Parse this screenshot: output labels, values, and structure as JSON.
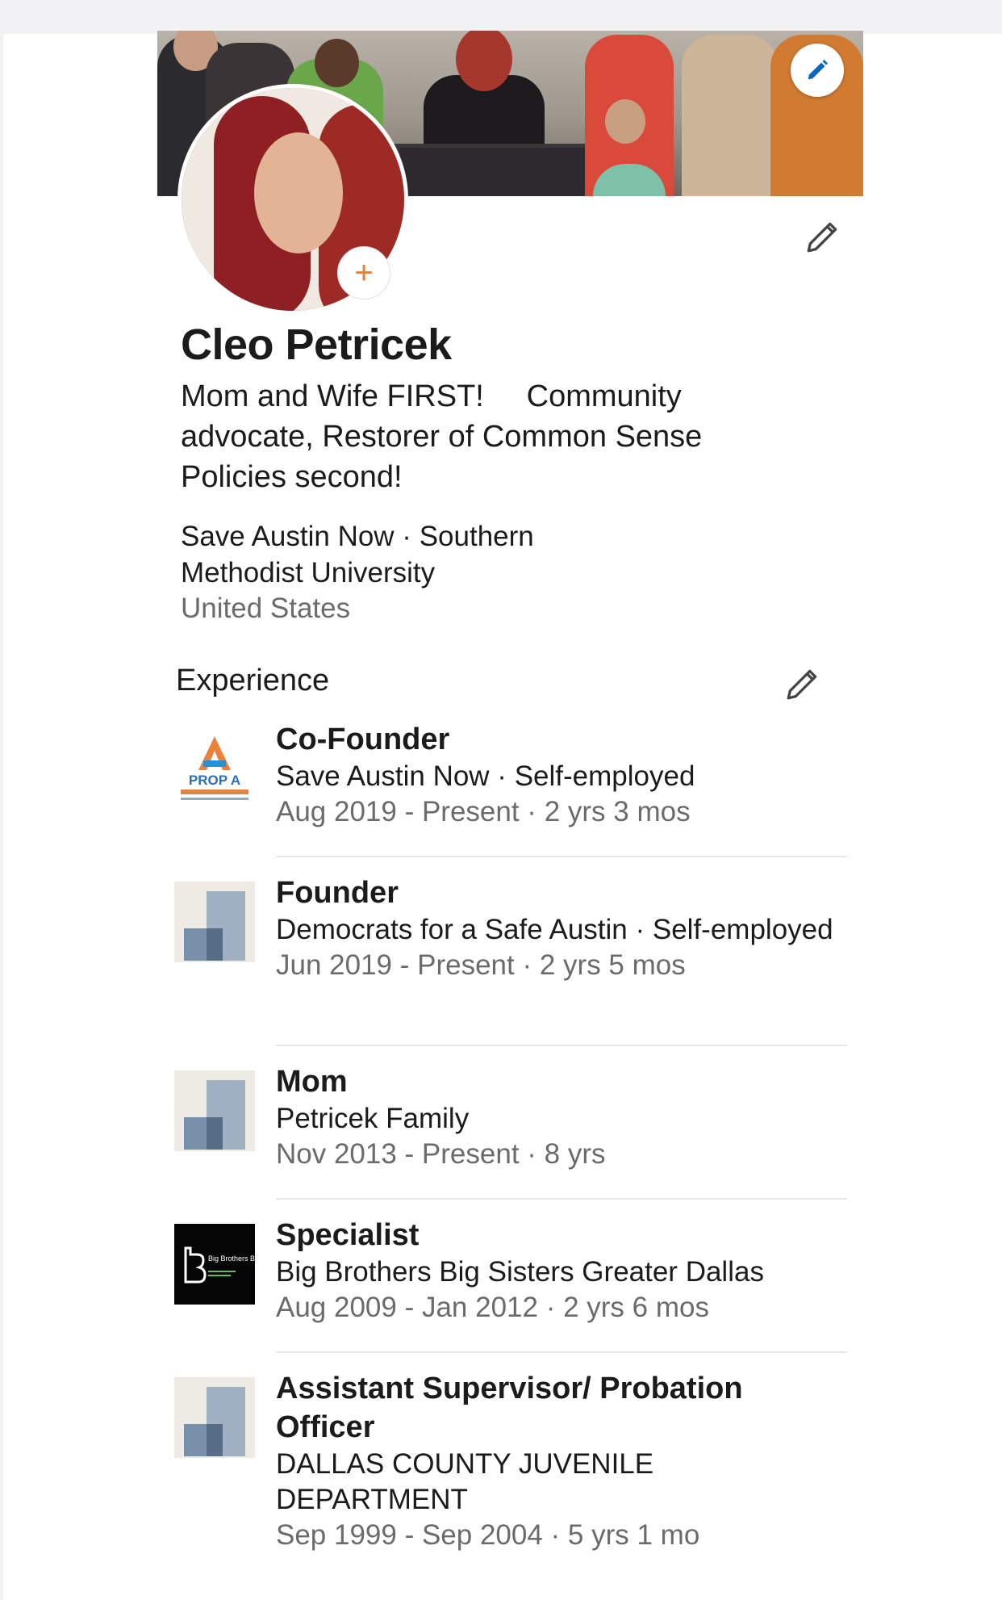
{
  "profile": {
    "name": "Cleo Petricek",
    "headline": "Mom and Wife FIRST!     Community advocate, Restorer of Common Sense Policies second!",
    "org_line": "Save Austin Now · Southern Methodist University",
    "location": "United States"
  },
  "icons": {
    "banner_edit": "pencil-icon",
    "add_photo": "plus-icon",
    "intro_edit": "pencil-icon",
    "experience_edit": "pencil-icon"
  },
  "colors": {
    "accent_blue": "#0a66c2",
    "add_orange": "#e47f38",
    "secondary_text": "#6b6b6b"
  },
  "add_photo_symbol": "+",
  "experience": {
    "title": "Experience",
    "items": [
      {
        "logo": "prop-a-logo",
        "logo_text": "PROP A",
        "title": "Co-Founder",
        "org": "Save Austin Now · Self-employed",
        "dates": "Aug 2019 - Present · 2 yrs 3 mos"
      },
      {
        "logo": "generic-company-logo",
        "title": "Founder",
        "org": "Democrats for a Safe Austin · Self-employed",
        "dates": "Jun 2019 - Present · 2 yrs 5 mos"
      },
      {
        "logo": "generic-company-logo",
        "title": "Mom",
        "org": "Petricek Family",
        "dates": "Nov 2013 - Present · 8 yrs"
      },
      {
        "logo": "big-brothers-big-sisters-logo",
        "logo_text": "Big Brothers Big Sisters",
        "title": "Specialist",
        "org": "Big Brothers Big Sisters Greater Dallas",
        "dates": "Aug 2009 - Jan 2012 · 2 yrs 6 mos"
      },
      {
        "logo": "generic-company-logo",
        "title": "Assistant Supervisor/ Probation Officer",
        "org": "DALLAS COUNTY JUVENILE DEPARTMENT",
        "dates": "Sep 1999 - Sep 2004 · 5 yrs 1 mo"
      }
    ]
  }
}
